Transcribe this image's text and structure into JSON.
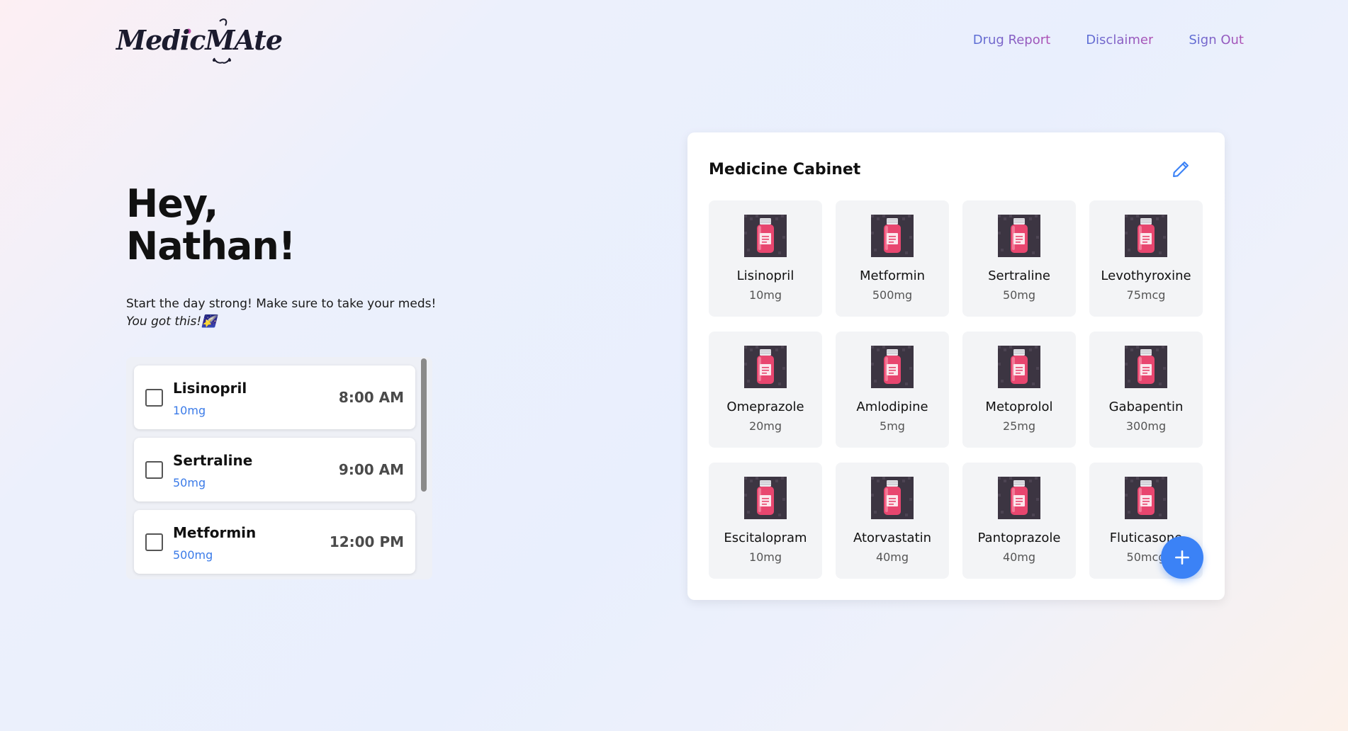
{
  "brand": {
    "logo_text": "MedicMAte"
  },
  "nav": {
    "items": [
      "Drug Report",
      "Disclaimer",
      "Sign Out"
    ]
  },
  "greeting": {
    "line1": "Hey,",
    "line2": "Nathan!",
    "lead": "Start the day strong! Make sure to take your meds!",
    "motto": "You got this!🌠"
  },
  "schedule": [
    {
      "name": "Lisinopril",
      "dose": "10mg",
      "time": "8:00 AM",
      "checked": false
    },
    {
      "name": "Sertraline",
      "dose": "50mg",
      "time": "9:00 AM",
      "checked": false
    },
    {
      "name": "Metformin",
      "dose": "500mg",
      "time": "12:00 PM",
      "checked": false
    }
  ],
  "cabinet": {
    "title": "Medicine Cabinet",
    "edit_icon": "pencil-icon",
    "add_icon": "plus-icon",
    "items": [
      {
        "name": "Lisinopril",
        "dose": "10mg"
      },
      {
        "name": "Metformin",
        "dose": "500mg"
      },
      {
        "name": "Sertraline",
        "dose": "50mg"
      },
      {
        "name": "Levothyroxine",
        "dose": "75mcg"
      },
      {
        "name": "Omeprazole",
        "dose": "20mg"
      },
      {
        "name": "Amlodipine",
        "dose": "5mg"
      },
      {
        "name": "Metoprolol",
        "dose": "25mg"
      },
      {
        "name": "Gabapentin",
        "dose": "300mg"
      },
      {
        "name": "Escitalopram",
        "dose": "10mg"
      },
      {
        "name": "Atorvastatin",
        "dose": "40mg"
      },
      {
        "name": "Pantoprazole",
        "dose": "40mg"
      },
      {
        "name": "Fluticasone",
        "dose": "50mcg"
      }
    ]
  },
  "colors": {
    "accent": "#3b82f6",
    "dose_blue": "#3b7be8",
    "bottle_pink": "#e8466f",
    "nav_gradient": [
      "#5a6fd6",
      "#b04fb3"
    ]
  }
}
